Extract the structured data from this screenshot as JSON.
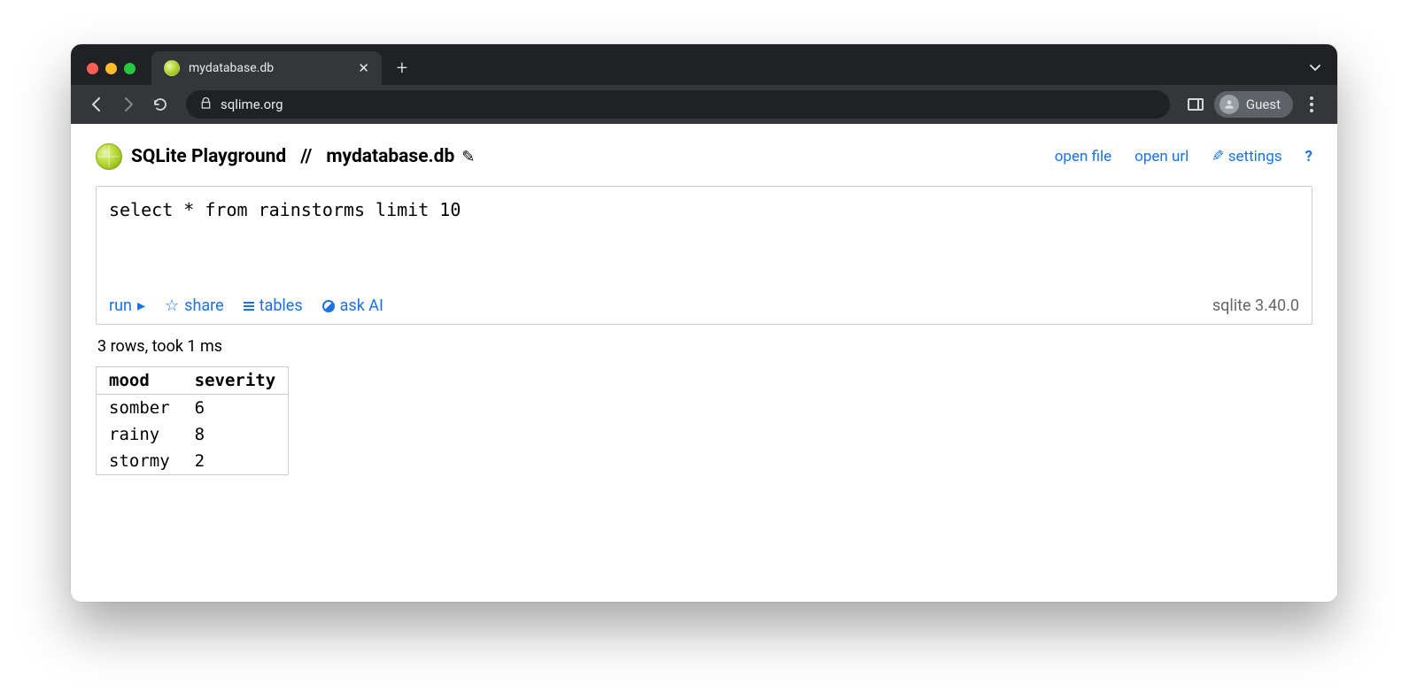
{
  "browser": {
    "tab_title": "mydatabase.db",
    "url_text": "sqlime.org",
    "guest_label": "Guest"
  },
  "header": {
    "app_title": "SQLite Playground",
    "separator": "//",
    "db_name": "mydatabase.db",
    "links": {
      "open_file": "open file",
      "open_url": "open url",
      "settings": "settings",
      "help": "?"
    }
  },
  "editor": {
    "sql": "select * from rainstorms limit 10",
    "actions": {
      "run": "run",
      "share": "share",
      "tables": "tables",
      "ask_ai": "ask AI"
    },
    "version": "sqlite 3.40.0"
  },
  "status": "3 rows, took 1 ms",
  "results": {
    "columns": [
      "mood",
      "severity"
    ],
    "rows": [
      [
        "somber",
        "6"
      ],
      [
        "rainy",
        "8"
      ],
      [
        "stormy",
        "2"
      ]
    ]
  }
}
